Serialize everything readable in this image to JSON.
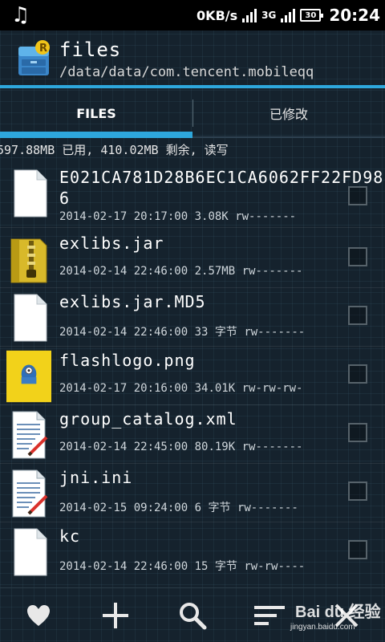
{
  "status_bar": {
    "music_icon": "music-note-icon",
    "net_speed": "0KB/s",
    "network_label": "3G",
    "battery_level": "30",
    "time": "20:24"
  },
  "app": {
    "title": "files",
    "path": "/data/data/com.tencent.mobileqq"
  },
  "tabs": [
    {
      "label": "FILES",
      "active": true
    },
    {
      "label": "已修改",
      "active": false
    }
  ],
  "storage_info": "597.88MB 已用, 410.02MB 剩余, 读写",
  "files": [
    {
      "name": "E021CA781D28B6EC1CA6062FF22FD986",
      "date": "2014-02-17 20:17:00",
      "size": "3.08K",
      "perms": "rw-------",
      "icon": "blank-file-icon"
    },
    {
      "name": "exlibs.jar",
      "date": "2014-02-14 22:46:00",
      "size": "2.57MB",
      "perms": "rw-------",
      "icon": "archive-jar-icon"
    },
    {
      "name": "exlibs.jar.MD5",
      "date": "2014-02-14 22:46:00",
      "size": "33 字节",
      "perms": "rw-------",
      "icon": "blank-file-icon"
    },
    {
      "name": "flashlogo.png",
      "date": "2014-02-17 20:16:00",
      "size": "34.01K",
      "perms": "rw-rw-rw-",
      "icon": "image-thumbnail-icon"
    },
    {
      "name": "group_catalog.xml",
      "date": "2014-02-14 22:45:00",
      "size": "80.19K",
      "perms": "rw-------",
      "icon": "text-file-icon"
    },
    {
      "name": "jni.ini",
      "date": "2014-02-15 09:24:00",
      "size": "6 字节",
      "perms": "rw-------",
      "icon": "text-file-icon"
    },
    {
      "name": "kc",
      "date": "2014-02-14 22:46:00",
      "size": "15 字节",
      "perms": "rw-rw----",
      "icon": "blank-file-icon"
    }
  ],
  "bottom_bar": [
    {
      "name": "favorite-button",
      "icon": "heart-icon"
    },
    {
      "name": "add-button",
      "icon": "plus-icon"
    },
    {
      "name": "search-button",
      "icon": "search-icon"
    },
    {
      "name": "sort-button",
      "icon": "sort-icon"
    },
    {
      "name": "close-button",
      "icon": "close-icon"
    }
  ],
  "watermark": {
    "logo": "Bai du 经验",
    "url": "jingyan.baidu.com"
  },
  "colors": {
    "accent": "#2ea7dc",
    "background": "#15222d",
    "status_bar": "#000000"
  }
}
